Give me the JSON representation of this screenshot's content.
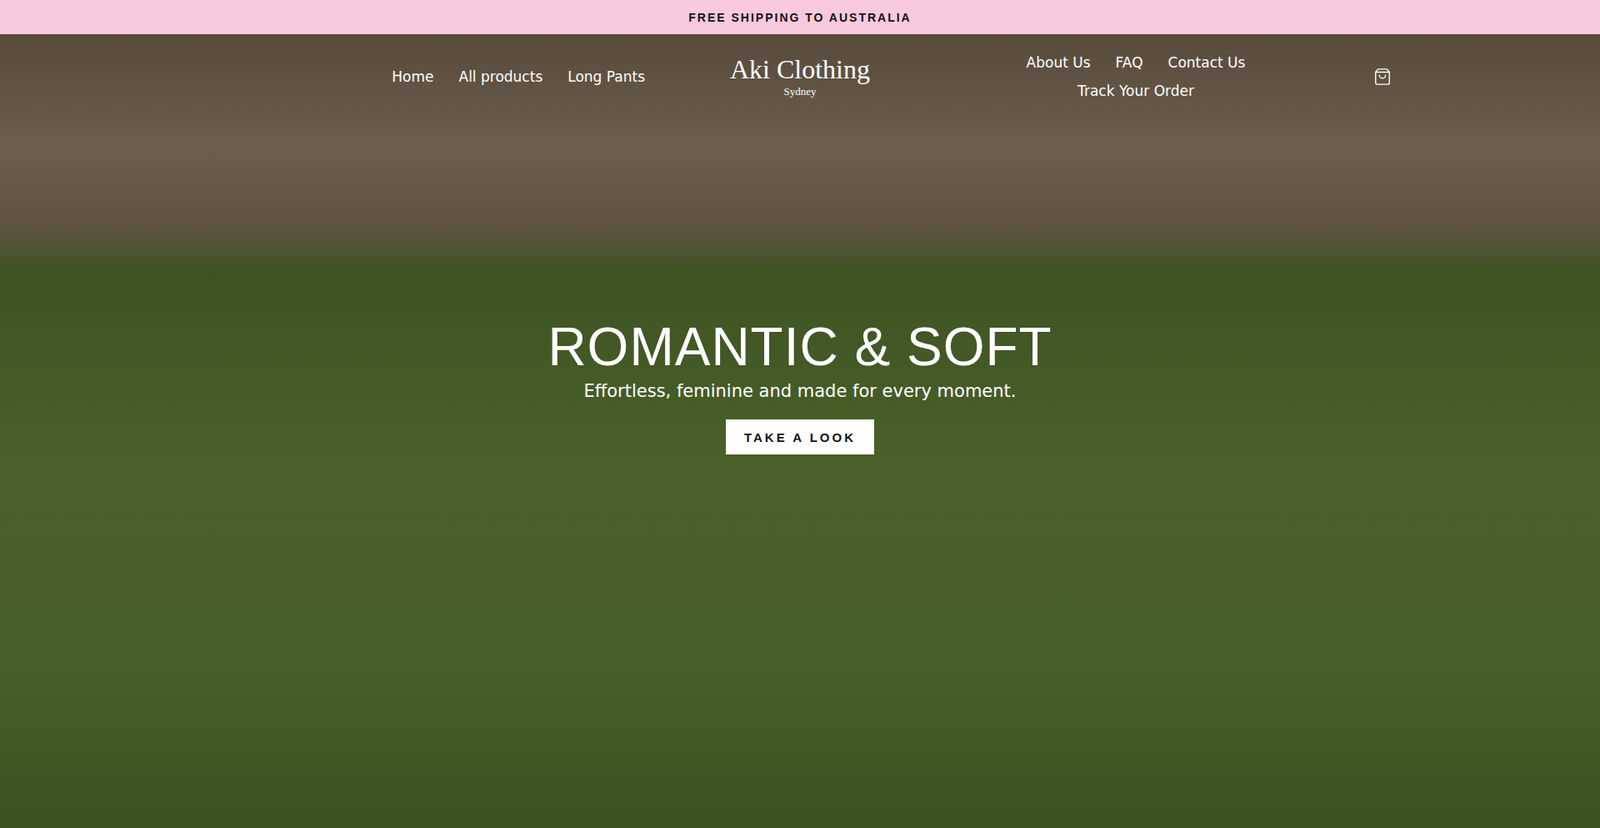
{
  "announcement": {
    "text": "FREE SHIPPING TO AUSTRALIA"
  },
  "header": {
    "logo": {
      "name": "Aki Clothing",
      "location": "Sydney"
    },
    "nav_left": [
      {
        "label": "Home"
      },
      {
        "label": "All products"
      },
      {
        "label": "Long Pants"
      }
    ],
    "nav_right": [
      {
        "label": "About Us"
      },
      {
        "label": "FAQ"
      },
      {
        "label": "Contact Us"
      },
      {
        "label": "Track Your Order"
      }
    ]
  },
  "hero": {
    "title": "ROMANTIC & SOFT",
    "subtitle": "Effortless, feminine and made for every moment.",
    "button": "TAKE A LOOK"
  }
}
